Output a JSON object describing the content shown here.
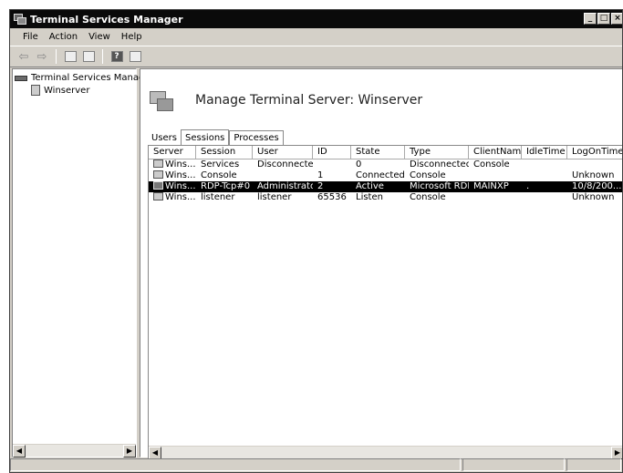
{
  "window": {
    "title": "Terminal Services Manager"
  },
  "menu": [
    "File",
    "Action",
    "View",
    "Help"
  ],
  "toolbar": {
    "icons": [
      "back-arrow-icon",
      "forward-arrow-icon",
      "up-level-icon",
      "show-hide-tree-icon",
      "help-icon",
      "console-icon"
    ],
    "help_glyph": "?"
  },
  "tree": {
    "root": "Terminal Services Manager",
    "child": "Winserver"
  },
  "main": {
    "title": "Manage Terminal Server: Winserver",
    "tabs": [
      {
        "label": "Users"
      },
      {
        "label": "Sessions"
      },
      {
        "label": "Processes"
      }
    ]
  },
  "sessions": {
    "columns": [
      "Server",
      "Session",
      "User",
      "ID",
      "State",
      "Type",
      "ClientName.",
      "IdleTime",
      "LogOnTime"
    ],
    "rows": [
      {
        "server": "Wins...",
        "session": "Services",
        "user": "Disconnected",
        "id": "",
        "state": "0",
        "type": "Disconnected",
        "client": "Console",
        "idle": "",
        "logon": ""
      },
      {
        "server": "Wins...",
        "session": "Console",
        "user": "",
        "id": "1",
        "state": "Connected",
        "type": "Console",
        "client": "",
        "idle": "",
        "logon": "Unknown"
      },
      {
        "server": "Wins...",
        "session": "RDP-Tcp#0",
        "user": "Administrator",
        "id": "2",
        "state": "Active",
        "type": "Microsoft RDP",
        "client": "MAINXP",
        "idle": ".",
        "logon": "10/8/200..."
      },
      {
        "server": "Wins...",
        "session": "listener",
        "user": "listener",
        "id": "65536",
        "state": "Listen",
        "type": "Console",
        "client": "",
        "idle": "",
        "logon": "Unknown"
      }
    ]
  },
  "colors": {
    "selection": "#000000",
    "chrome": "#d4d0c8",
    "titlebar": "#0a0a0a"
  }
}
